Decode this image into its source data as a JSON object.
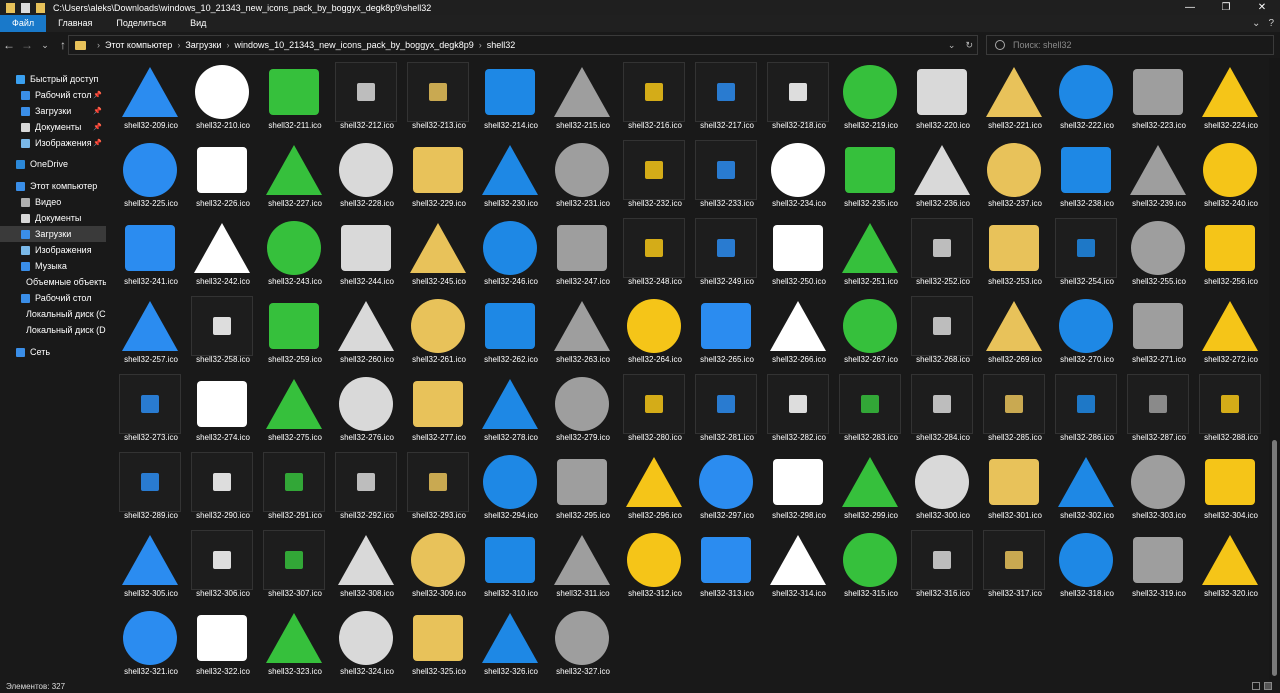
{
  "window": {
    "path_title": "C:\\Users\\aleks\\Downloads\\windows_10_21343_new_icons_pack_by_boggyx_degk8p9\\shell32",
    "controls": [
      "—",
      "❐",
      "✕"
    ]
  },
  "ribbon": {
    "tabs": [
      "Файл",
      "Главная",
      "Поделиться",
      "Вид"
    ],
    "active": "Файл"
  },
  "address": {
    "crumbs": [
      "Этот компьютер",
      "Загрузки",
      "windows_10_21343_new_icons_pack_by_boggyx_degk8p9",
      "shell32"
    ],
    "search_placeholder": "Поиск: shell32"
  },
  "nav": {
    "items": [
      {
        "label": "Быстрый доступ",
        "icon": "star-icon",
        "color": "#3aa0f0",
        "indent": 0,
        "pinned": false
      },
      {
        "label": "Рабочий стол",
        "icon": "desktop-icon",
        "color": "#3a8ee8",
        "indent": 1,
        "pinned": true
      },
      {
        "label": "Загрузки",
        "icon": "download-icon",
        "color": "#3a8ee8",
        "indent": 1,
        "pinned": true
      },
      {
        "label": "Документы",
        "icon": "documents-icon",
        "color": "#d8d8d8",
        "indent": 1,
        "pinned": true
      },
      {
        "label": "Изображения",
        "icon": "pictures-icon",
        "color": "#7ab8e8",
        "indent": 1,
        "pinned": true
      },
      {
        "label": "OneDrive",
        "icon": "cloud-icon",
        "color": "#2b88d8",
        "indent": 0,
        "pinned": false
      },
      {
        "label": "Этот компьютер",
        "icon": "computer-icon",
        "color": "#3a8ee8",
        "indent": 0,
        "pinned": false
      },
      {
        "label": "Видео",
        "icon": "video-icon",
        "color": "#b0b0b0",
        "indent": 1,
        "pinned": false
      },
      {
        "label": "Документы",
        "icon": "documents-icon",
        "color": "#d8d8d8",
        "indent": 1,
        "pinned": false
      },
      {
        "label": "Загрузки",
        "icon": "download-icon",
        "color": "#3a8ee8",
        "indent": 1,
        "pinned": false,
        "selected": true
      },
      {
        "label": "Изображения",
        "icon": "pictures-icon",
        "color": "#7ab8e8",
        "indent": 1,
        "pinned": false
      },
      {
        "label": "Музыка",
        "icon": "music-icon",
        "color": "#3a8ee8",
        "indent": 1,
        "pinned": false
      },
      {
        "label": "Объемные объекты",
        "icon": "3d-objects-icon",
        "color": "#3a8ee8",
        "indent": 1,
        "pinned": false
      },
      {
        "label": "Рабочий стол",
        "icon": "desktop-icon",
        "color": "#3a8ee8",
        "indent": 1,
        "pinned": false
      },
      {
        "label": "Локальный диск (C:)",
        "icon": "drive-icon",
        "color": "#9a9a9a",
        "indent": 1,
        "pinned": false
      },
      {
        "label": "Локальный диск (D:)",
        "icon": "drive-icon",
        "color": "#9a9a9a",
        "indent": 1,
        "pinned": false
      },
      {
        "label": "Сеть",
        "icon": "network-icon",
        "color": "#3a8ee8",
        "indent": 0,
        "pinned": false
      }
    ]
  },
  "files": {
    "start": 209,
    "end": 327,
    "prefix": "shell32-",
    "suffix": ".ico",
    "boxed": [
      212,
      213,
      216,
      217,
      218,
      232,
      233,
      248,
      249,
      252,
      254,
      258,
      268,
      273,
      280,
      281,
      282,
      283,
      284,
      285,
      286,
      287,
      288,
      289,
      290,
      291,
      292,
      293,
      306,
      307,
      316,
      317
    ]
  },
  "status": {
    "count_text": "Элементов: 327"
  }
}
